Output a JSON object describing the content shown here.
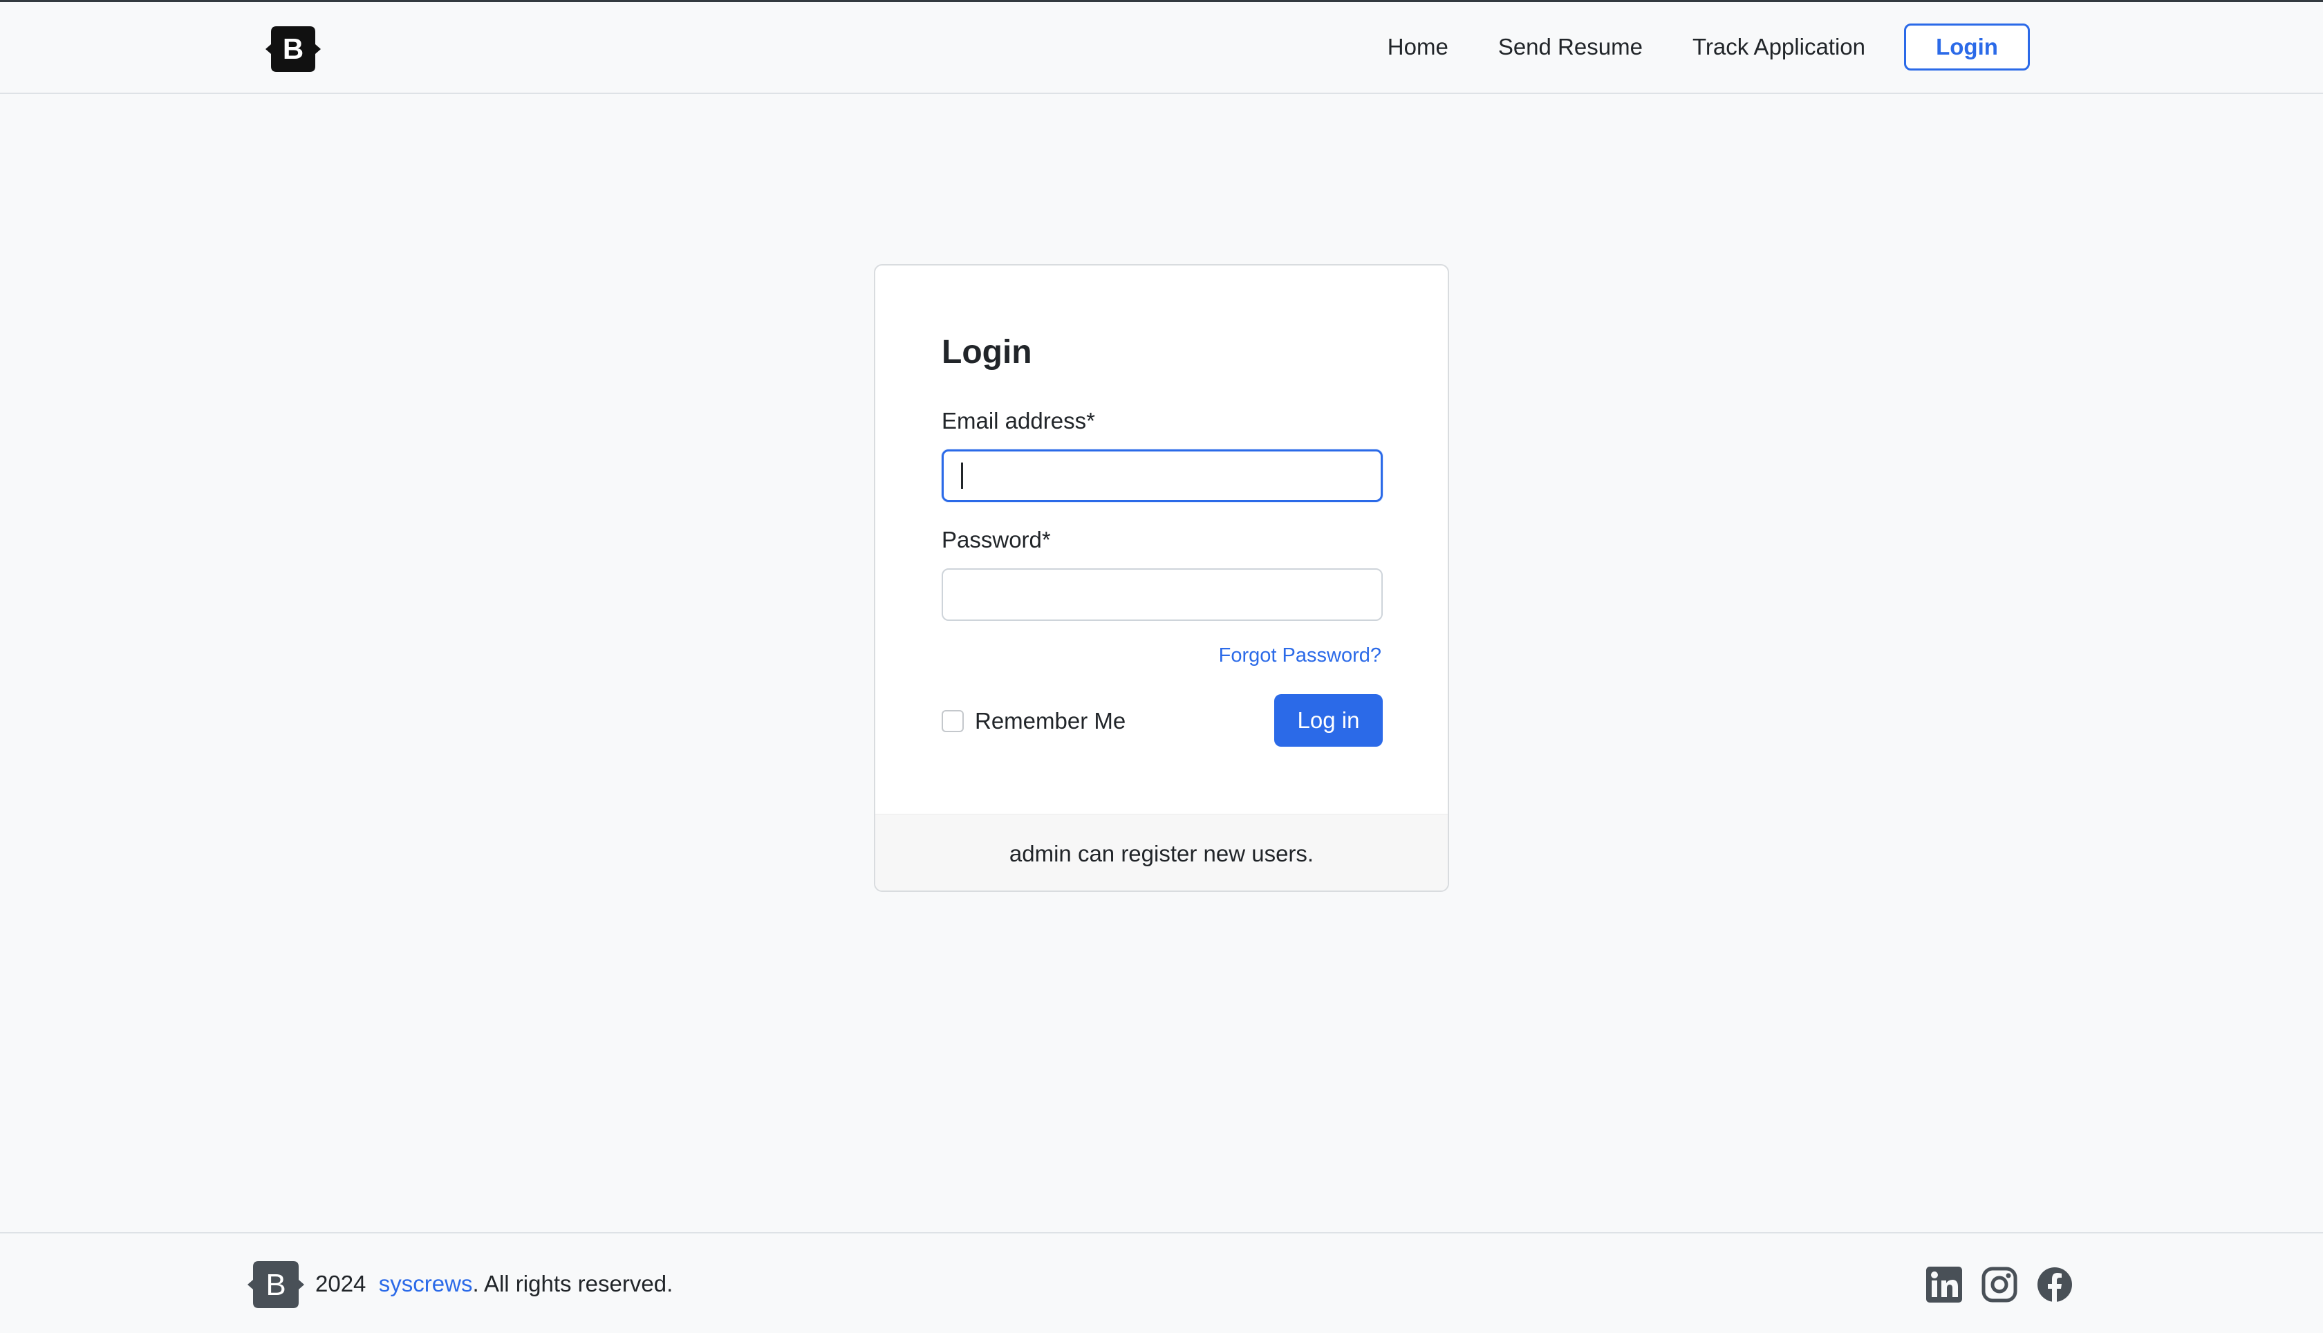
{
  "header": {
    "logo_letter": "B",
    "nav": {
      "home": "Home",
      "send_resume": "Send Resume",
      "track_application": "Track Application",
      "login": "Login"
    }
  },
  "login_card": {
    "title": "Login",
    "email_label": "Email address*",
    "email_value": "",
    "password_label": "Password*",
    "password_value": "",
    "forgot_password": "Forgot Password?",
    "remember_me": "Remember Me",
    "remember_checked": false,
    "submit_label": "Log in",
    "footer_note": "admin can register new users."
  },
  "footer": {
    "logo_letter": "B",
    "year": "2024",
    "company_link": "syscrews",
    "rights": ". All rights reserved.",
    "social": [
      "linkedin-icon",
      "instagram-icon",
      "facebook-icon"
    ]
  },
  "colors": {
    "accent": "#2b6ae8",
    "page_bg": "#f8f9fa",
    "text": "#212529",
    "logo_dark": "#111111",
    "logo_gray": "#495057",
    "social_gray": "#495057"
  }
}
